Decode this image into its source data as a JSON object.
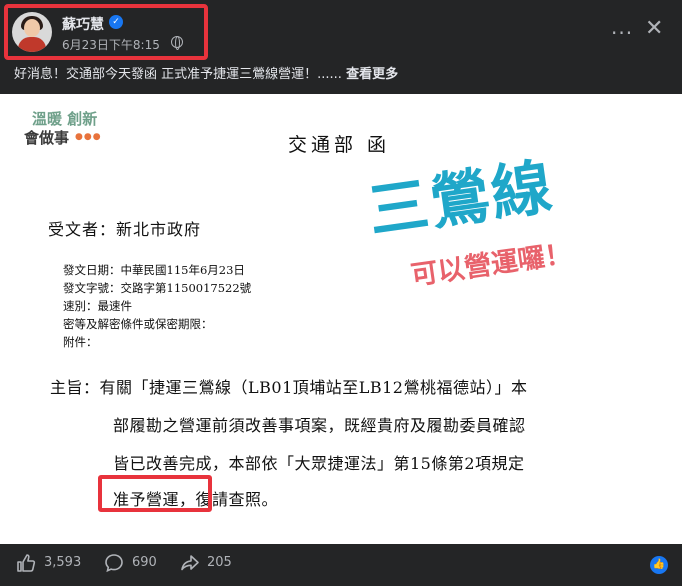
{
  "author": {
    "name": "蘇巧慧",
    "time": "6月23日下午8:15"
  },
  "caption": {
    "text": "好消息！交通部今天發函 正式准予捷運三鶯線營運！......",
    "see_more": "查看更多"
  },
  "image": {
    "tagline_line1": "溫暖 創新",
    "tagline_line2": "會做事",
    "doc_title": "交通部 函",
    "recipient": "受文者：新北市政府",
    "meta": [
      "發文日期：中華民國115年6月23日",
      "發文字號：交路字第1150017522號",
      "速別：最速件",
      "密等及解密條件或保密期限：",
      "附件："
    ],
    "body_lines": [
      "主旨：有關「捷運三鶯線（LB01頂埔站至LB12鶯桃福德站）」本",
      "部履勘之營運前須改善事項案，既經貴府及履勘委員確認",
      "皆已改善完成，本部依「大眾捷運法」第15條第2項規定",
      "准予營運，復請查照。"
    ],
    "big_title": "三鶯線",
    "sub_title": "可以營運囉！"
  },
  "stats": {
    "likes": "3,593",
    "comments": "690",
    "shares": "205"
  },
  "colors": {
    "highlight": "#e8333c",
    "accent_blue": "#1fa7c9",
    "accent_pink": "#e8626b",
    "facebook_blue": "#1877f2"
  }
}
